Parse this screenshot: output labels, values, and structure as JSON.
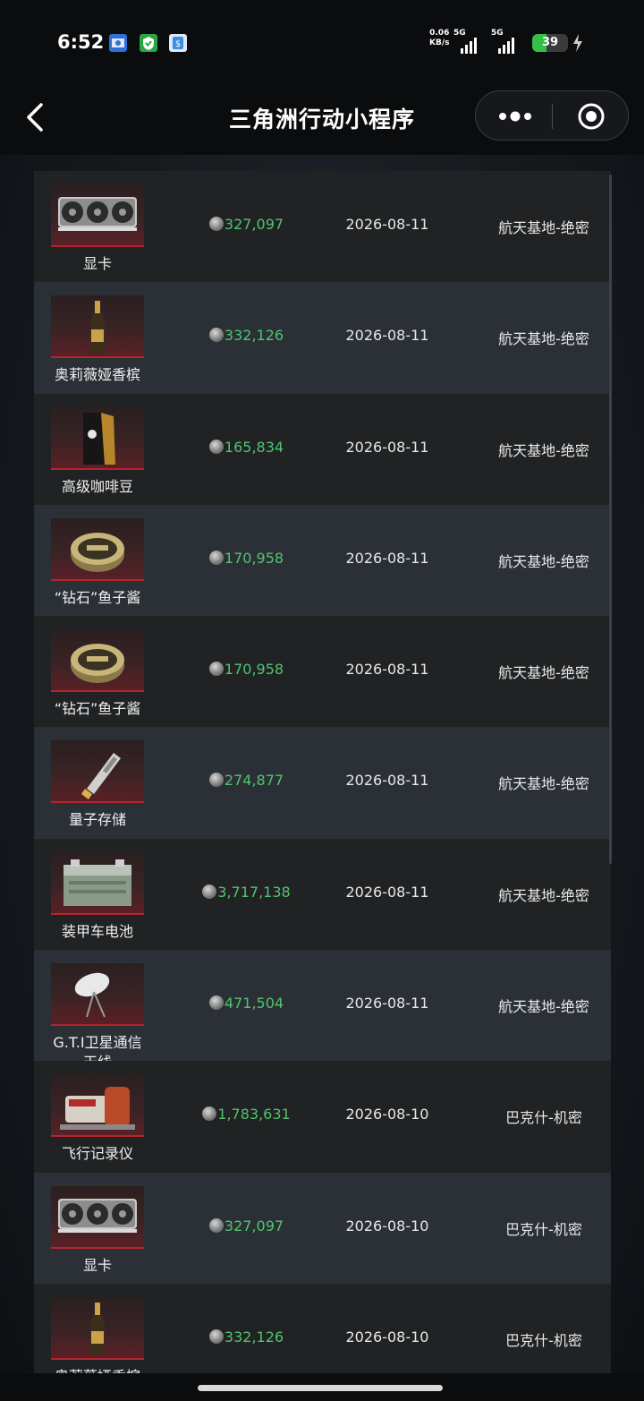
{
  "status_bar": {
    "time": "6:52",
    "net_speed_value": "0.06",
    "net_speed_unit": "KB/s",
    "sim1_label": "5G",
    "sim2_label": "5G",
    "battery_level": "39",
    "battery_fraction": 0.39,
    "notification_icons": [
      "app-icon-blue",
      "shield-icon-green",
      "payment-icon-blue"
    ]
  },
  "nav": {
    "title": "三角洲行动小程序",
    "back_icon": "chevron-left-icon",
    "more_icon": "more-dots-icon",
    "close_icon": "target-circle-icon"
  },
  "colors": {
    "price": "#52c46e",
    "thumb_border": "#b2252e",
    "row_dark": "#202224",
    "row_light": "#2a3036"
  },
  "records": [
    {
      "name": "显卡",
      "item_icon": "graphics-card-icon",
      "price": "327,097",
      "date": "2026-08-11",
      "map": "航天基地-绝密"
    },
    {
      "name": "奥莉薇娅香槟",
      "item_icon": "champagne-bottle-icon",
      "price": "332,126",
      "date": "2026-08-11",
      "map": "航天基地-绝密"
    },
    {
      "name": "高级咖啡豆",
      "item_icon": "coffee-bag-icon",
      "price": "165,834",
      "date": "2026-08-11",
      "map": "航天基地-绝密"
    },
    {
      "name": "“钻石”鱼子酱",
      "item_icon": "caviar-tin-icon",
      "price": "170,958",
      "date": "2026-08-11",
      "map": "航天基地-绝密"
    },
    {
      "name": "“钻石”鱼子酱",
      "item_icon": "caviar-tin-icon",
      "price": "170,958",
      "date": "2026-08-11",
      "map": "航天基地-绝密"
    },
    {
      "name": "量子存储",
      "item_icon": "quantum-storage-icon",
      "price": "274,877",
      "date": "2026-08-11",
      "map": "航天基地-绝密"
    },
    {
      "name": "装甲车电池",
      "item_icon": "vehicle-battery-icon",
      "price": "3,717,138",
      "date": "2026-08-11",
      "map": "航天基地-绝密"
    },
    {
      "name": "G.T.I卫星通信天线",
      "item_icon": "satellite-dish-icon",
      "price": "471,504",
      "date": "2026-08-11",
      "map": "航天基地-绝密"
    },
    {
      "name": "飞行记录仪",
      "item_icon": "flight-recorder-icon",
      "price": "1,783,631",
      "date": "2026-08-10",
      "map": "巴克什-机密"
    },
    {
      "name": "显卡",
      "item_icon": "graphics-card-icon",
      "price": "327,097",
      "date": "2026-08-10",
      "map": "巴克什-机密"
    },
    {
      "name": "奥莉薇娅香槟",
      "item_icon": "champagne-bottle-icon",
      "price": "332,126",
      "date": "2026-08-10",
      "map": "巴克什-机密"
    }
  ]
}
